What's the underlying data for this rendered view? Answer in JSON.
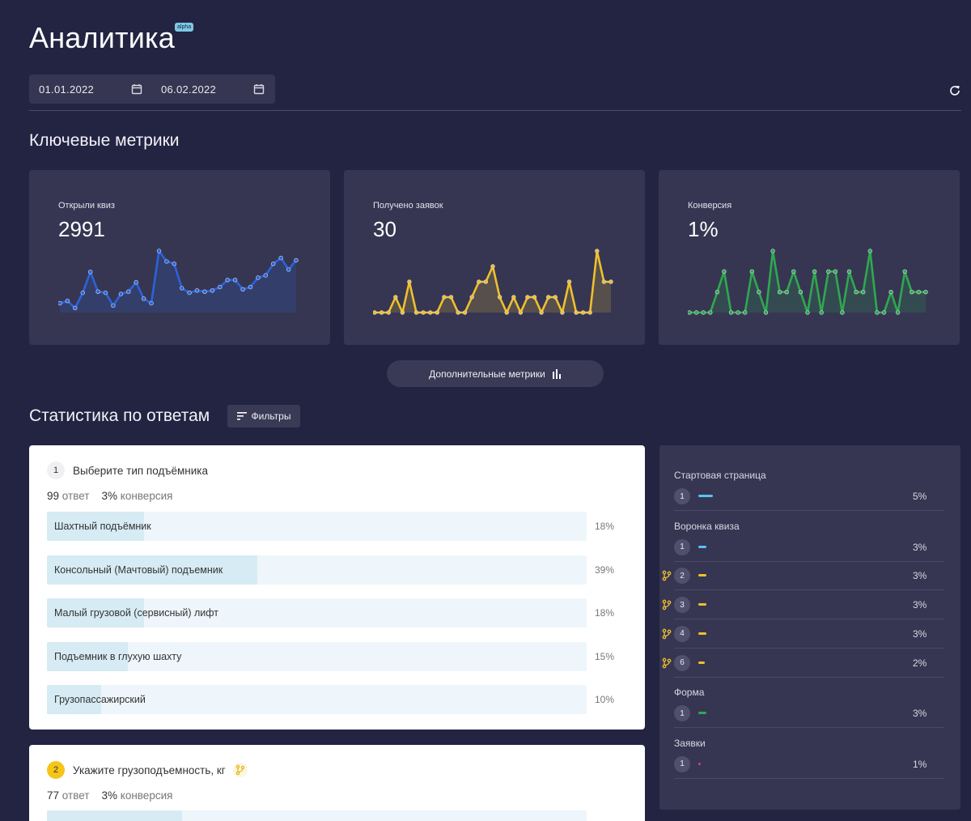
{
  "header": {
    "title": "Аналитика",
    "badge": "alpha",
    "date_from": "01.01.2022",
    "date_to": "06.02.2022",
    "refresh_icon": "refresh-icon",
    "calendar_icon": "calendar-icon"
  },
  "key_metrics": {
    "title": "Ключевые метрики",
    "cards": [
      {
        "label": "Открыли квиз",
        "value": "2991",
        "color": "#2b63d9",
        "series": [
          8,
          10,
          4,
          17,
          35,
          18,
          17,
          6,
          16,
          18,
          26,
          12,
          8,
          53,
          44,
          42,
          21,
          17,
          19,
          18,
          19,
          22,
          28,
          28,
          20,
          22,
          30,
          32,
          42,
          47,
          37,
          45
        ]
      },
      {
        "label": "Получено заявок",
        "value": "30",
        "color": "#f0c02c",
        "series": [
          0,
          0,
          0,
          1,
          0,
          2,
          0,
          0,
          0,
          0,
          1,
          1,
          0,
          0,
          1,
          2,
          2,
          3,
          1,
          0,
          1,
          0,
          1,
          1,
          0,
          1,
          1,
          0,
          2,
          0,
          0,
          0,
          4,
          2,
          2
        ]
      },
      {
        "label": "Конверсия",
        "value": "1%",
        "color": "#2fa84f",
        "series": [
          0,
          0,
          0,
          0,
          1,
          2,
          0,
          0,
          0,
          2,
          1,
          0,
          3,
          1,
          1,
          2,
          1,
          0,
          2,
          0,
          2,
          2,
          0,
          2,
          1,
          1,
          3,
          0,
          0,
          1,
          0,
          2,
          1,
          1,
          1
        ]
      }
    ]
  },
  "more_metrics_button": "Дополнительные метрики",
  "answers_section": {
    "title": "Статистика по ответам",
    "filter_button": "Фильтры",
    "questions": [
      {
        "number": "1",
        "title": "Выберите тип подъёмника",
        "answers_count": "99",
        "answers_label": "ответ",
        "conversion": "3%",
        "conversion_label": "конверсия",
        "answers": [
          {
            "label": "Шахтный подъёмник",
            "percent": "18%",
            "fraction": 0.18
          },
          {
            "label": "Консольный (Мачтовый) подъемник",
            "percent": "39%",
            "fraction": 0.39
          },
          {
            "label": "Малый грузовой (сервисный) лифт",
            "percent": "18%",
            "fraction": 0.18
          },
          {
            "label": "Подъемник в глухую шахту",
            "percent": "15%",
            "fraction": 0.15
          },
          {
            "label": "Грузопассажирский",
            "percent": "10%",
            "fraction": 0.1
          }
        ]
      },
      {
        "number": "2",
        "title": "Укажите грузоподъемность, кг",
        "answers_count": "77",
        "answers_label": "ответ",
        "conversion": "3%",
        "conversion_label": "конверсия",
        "first_answer_fraction": 0.25
      }
    ]
  },
  "funnel": {
    "groups": [
      {
        "title": "Стартовая страница",
        "rows": [
          {
            "num": "1",
            "percent": "5%",
            "bar_color": "#58c4ee",
            "branch": false
          }
        ]
      },
      {
        "title": "Воронка квиза",
        "rows": [
          {
            "num": "1",
            "percent": "3%",
            "bar_color": "#58c4ee",
            "branch": false
          },
          {
            "num": "2",
            "percent": "3%",
            "bar_color": "#f0c02c",
            "branch": true
          },
          {
            "num": "3",
            "percent": "3%",
            "bar_color": "#f0c02c",
            "branch": true
          },
          {
            "num": "4",
            "percent": "3%",
            "bar_color": "#f0c02c",
            "branch": true
          },
          {
            "num": "6",
            "percent": "2%",
            "bar_color": "#f0c02c",
            "branch": true
          }
        ]
      },
      {
        "title": "Форма",
        "rows": [
          {
            "num": "1",
            "percent": "3%",
            "bar_color": "#2fa84f",
            "branch": false
          }
        ]
      },
      {
        "title": "Заявки",
        "rows": [
          {
            "num": "1",
            "percent": "1%",
            "bar_color": "#e23b6a",
            "branch": false
          }
        ]
      }
    ]
  }
}
